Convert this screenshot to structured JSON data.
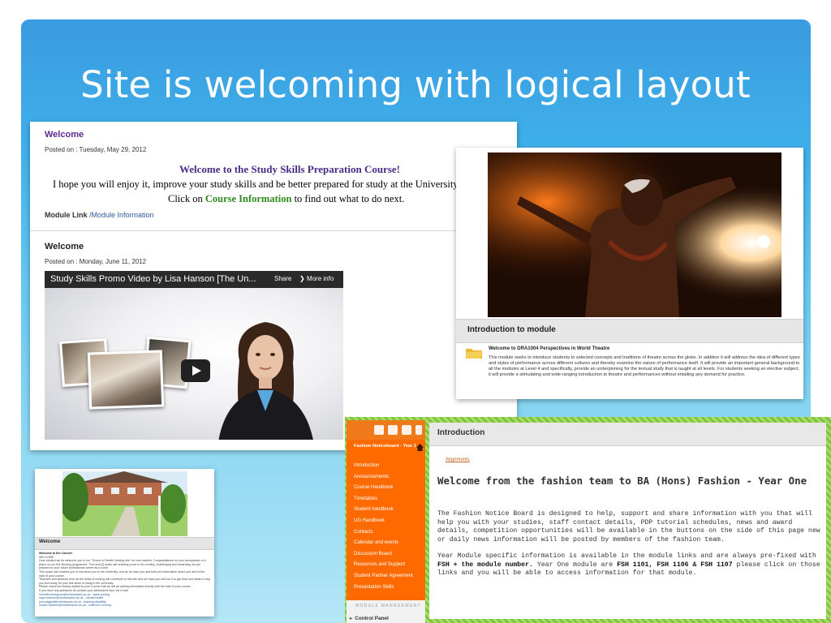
{
  "slide": {
    "title": "Site is welcoming with logical layout"
  },
  "study_skills": {
    "heading": "Welcome",
    "posted": "Posted on : Tuesday, May 29, 2012",
    "welcome_line": "Welcome to the Study Skills Preparation Course!",
    "hope_line": "I hope you will enjoy it, improve your study skills and be better prepared for study at the University of No",
    "click_pre": "Click on",
    "click_link": "Course Information",
    "click_post": "to find out what to do next.",
    "module_link_label": "Module Link",
    "module_link_value": "/Module Information",
    "heading2": "Welcome",
    "posted2": "Posted on : Monday, June 11, 2012",
    "video": {
      "title": "Study Skills Promo Video by Lisa Hanson [The Un...",
      "share": "Share",
      "more_info": "More info"
    }
  },
  "theatre": {
    "header": "Introduction to module",
    "subheading": "Welcome to DRA1004 Perspectives in World Theatre",
    "text": "This module seeks to introduce students to selected concepts and traditions of theatre across the globe. In addition it will address the idea of different types and styles of performance across different cultures and thereby examine the nature of performance itself. It will provide an important general background to all the modules at Level 4 and specifically, provide an underpinning for the textual study that is taught at all levels. For students seeking an elective subject, it will provide a stimulating and wide-ranging introduction to theatre and performances without entailing any demand for practice."
  },
  "building": {
    "header": "Welcome",
    "line_title": "Welcome to the Course!",
    "line_hello": "WELCOME",
    "line_body": "Dear student we do welcome you to our \"School of Health Nursing site\" for new starters. Congratulations on your acceptance of a place on our fine Nursing programme. The next [2] years will certainly prove to be exciting, challenging and rewarding, as you prepare for your future professional career as a nurse.",
    "line_guide": "This space site enables you to introduce you to the university, and as do have you and both pre-information about you and to the start of your course.",
    "line_teach": "Teachers and students from all the fields of nursing will contribute to this site and we hope you will use it to get help and ideas to help you find ready for your first week of study in the university.",
    "line_check": "Please check the history related to your Course that we will be adding information shortly until the start of your course.",
    "line_ask": "If you have any questions do contact your admissions tutor via e-mail",
    "contacts": [
      "michelle.thompson@northampton.ac.uk - adult nursing",
      "roger.beeson@northampton.ac.uk - mental health",
      "john.piggott@northampton.ac.uk - learning disability",
      "louise.rowntree@northampton.ac.uk - children's nursing"
    ]
  },
  "fashion": {
    "course_name": "Fashion Noticeboard - Year 1",
    "menu": [
      "Introduction",
      "Announcements",
      "Course Handbook",
      "Timetables",
      "Student handbook",
      "UG Handbook",
      "Contacts",
      "Calendar and events",
      "Discussion Board",
      "Resources and Support",
      "Student Partner Agreement",
      "Presentation Skills"
    ],
    "module_management": "MODULE MANAGEMENT",
    "control_panel": "Control Panel",
    "page_title": "Introduction",
    "alignments": "Alignments",
    "heading": "Welcome from the fashion team to BA (Hons) Fashion - Year One",
    "p1": "The Fashion Notice Board is designed to help, support and share information with you that will help you with your studies, staff contact details, PDP tutorial schedules, news and award details, competition  opportunities will be available in the buttons on the side of this page new or daily news information will be posted by members of the fashion team.",
    "p2_a": "Year Module specific information is available in the module links and are always pre-fixed with",
    "p2_b": "FSH + the module number.",
    "p2_c": " Year One module are",
    "p2_d": "FSH 1101, FSH 1106 & FSH 1107",
    "p2_e": " please click on those links and you will be able to access information for that module."
  },
  "colors": {
    "slide_blue": "#3fb0ea",
    "study_purple": "#4b2a86",
    "link_green": "#2f8a1e",
    "fashion_orange": "#ff6a00",
    "fashion_green": "#8fd14f"
  }
}
